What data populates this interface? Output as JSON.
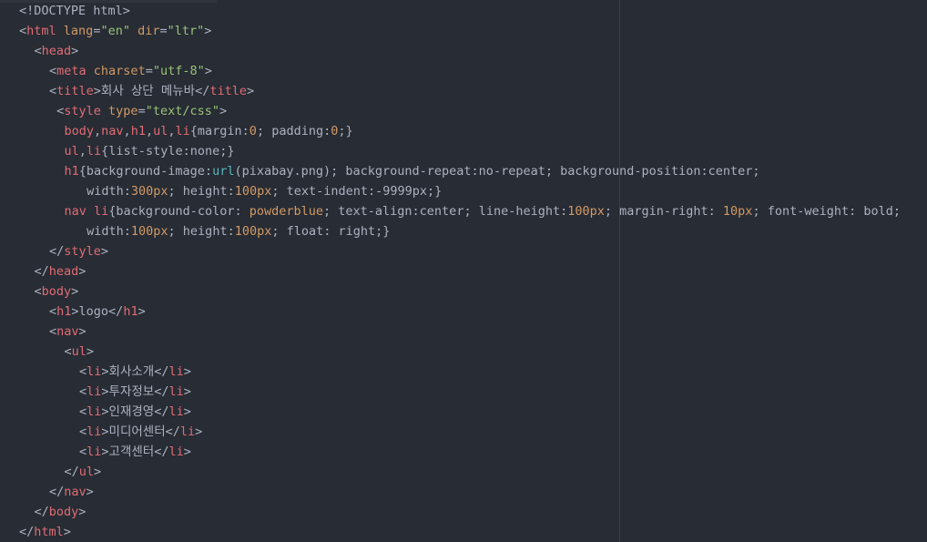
{
  "editor": {
    "theme_colors": {
      "background": "#282c34",
      "plain": "#abb2bf",
      "tag": "#e06c75",
      "attr": "#d19a66",
      "string": "#98c379",
      "number": "#d19a66",
      "function": "#56b6c2"
    },
    "lines": [
      {
        "indent": 1,
        "tokens": [
          {
            "t": "plain",
            "v": "<!DOCTYPE html>"
          }
        ]
      },
      {
        "indent": 1,
        "tokens": [
          {
            "t": "plain",
            "v": "<"
          },
          {
            "t": "tag",
            "v": "html"
          },
          {
            "t": "plain",
            "v": " "
          },
          {
            "t": "attr",
            "v": "lang"
          },
          {
            "t": "plain",
            "v": "="
          },
          {
            "t": "str",
            "v": "\"en\""
          },
          {
            "t": "plain",
            "v": " "
          },
          {
            "t": "attr",
            "v": "dir"
          },
          {
            "t": "plain",
            "v": "="
          },
          {
            "t": "str",
            "v": "\"ltr\""
          },
          {
            "t": "plain",
            "v": ">"
          }
        ]
      },
      {
        "indent": 2,
        "tokens": [
          {
            "t": "plain",
            "v": "<"
          },
          {
            "t": "tag",
            "v": "head"
          },
          {
            "t": "plain",
            "v": ">"
          }
        ]
      },
      {
        "indent": 3,
        "tokens": [
          {
            "t": "plain",
            "v": "<"
          },
          {
            "t": "tag",
            "v": "meta"
          },
          {
            "t": "plain",
            "v": " "
          },
          {
            "t": "attr",
            "v": "charset"
          },
          {
            "t": "plain",
            "v": "="
          },
          {
            "t": "str",
            "v": "\"utf-8\""
          },
          {
            "t": "plain",
            "v": ">"
          }
        ]
      },
      {
        "indent": 3,
        "tokens": [
          {
            "t": "plain",
            "v": "<"
          },
          {
            "t": "tag",
            "v": "title"
          },
          {
            "t": "plain",
            "v": ">회사 상단 메뉴바</"
          },
          {
            "t": "tag",
            "v": "title"
          },
          {
            "t": "plain",
            "v": ">"
          }
        ]
      },
      {
        "indent": 3,
        "tokens": [
          {
            "t": "plain",
            "v": " <"
          },
          {
            "t": "tag",
            "v": "style"
          },
          {
            "t": "plain",
            "v": " "
          },
          {
            "t": "attr",
            "v": "type"
          },
          {
            "t": "plain",
            "v": "="
          },
          {
            "t": "str",
            "v": "\"text/css\""
          },
          {
            "t": "plain",
            "v": ">"
          }
        ]
      },
      {
        "indent": 4,
        "tokens": [
          {
            "t": "tag",
            "v": "body"
          },
          {
            "t": "plain",
            "v": ","
          },
          {
            "t": "tag",
            "v": "nav"
          },
          {
            "t": "plain",
            "v": ","
          },
          {
            "t": "tag",
            "v": "h1"
          },
          {
            "t": "plain",
            "v": ","
          },
          {
            "t": "tag",
            "v": "ul"
          },
          {
            "t": "plain",
            "v": ","
          },
          {
            "t": "tag",
            "v": "li"
          },
          {
            "t": "plain",
            "v": "{margin:"
          },
          {
            "t": "num",
            "v": "0"
          },
          {
            "t": "plain",
            "v": "; padding:"
          },
          {
            "t": "num",
            "v": "0"
          },
          {
            "t": "plain",
            "v": ";}"
          }
        ]
      },
      {
        "indent": 4,
        "tokens": [
          {
            "t": "tag",
            "v": "ul"
          },
          {
            "t": "plain",
            "v": ","
          },
          {
            "t": "tag",
            "v": "li"
          },
          {
            "t": "plain",
            "v": "{list-style:none;}"
          }
        ]
      },
      {
        "indent": 4,
        "tokens": [
          {
            "t": "tag",
            "v": "h1"
          },
          {
            "t": "plain",
            "v": "{background-image:"
          },
          {
            "t": "fn",
            "v": "url"
          },
          {
            "t": "plain",
            "v": "(pixabay.png); background-repeat:no-repeat; background-position:center;"
          }
        ]
      },
      {
        "indent": 5,
        "tokens": [
          {
            "t": "plain",
            "v": " width:"
          },
          {
            "t": "num",
            "v": "300px"
          },
          {
            "t": "plain",
            "v": "; height:"
          },
          {
            "t": "num",
            "v": "100px"
          },
          {
            "t": "plain",
            "v": "; text-indent:-9999px;}"
          }
        ]
      },
      {
        "indent": 4,
        "tokens": [
          {
            "t": "tag",
            "v": "nav"
          },
          {
            "t": "plain",
            "v": " "
          },
          {
            "t": "tag",
            "v": "li"
          },
          {
            "t": "plain",
            "v": "{background-color: "
          },
          {
            "t": "num",
            "v": "powderblue"
          },
          {
            "t": "plain",
            "v": "; text-align:center; line-height:"
          },
          {
            "t": "num",
            "v": "100px"
          },
          {
            "t": "plain",
            "v": "; margin-right: "
          },
          {
            "t": "num",
            "v": "10px"
          },
          {
            "t": "plain",
            "v": "; font-weight: bold;"
          }
        ]
      },
      {
        "indent": 5,
        "tokens": [
          {
            "t": "plain",
            "v": " width:"
          },
          {
            "t": "num",
            "v": "100px"
          },
          {
            "t": "plain",
            "v": "; height:"
          },
          {
            "t": "num",
            "v": "100px"
          },
          {
            "t": "plain",
            "v": "; float: right;}"
          }
        ]
      },
      {
        "indent": 3,
        "tokens": [
          {
            "t": "plain",
            "v": "</"
          },
          {
            "t": "tag",
            "v": "style"
          },
          {
            "t": "plain",
            "v": ">"
          }
        ]
      },
      {
        "indent": 2,
        "tokens": [
          {
            "t": "plain",
            "v": "</"
          },
          {
            "t": "tag",
            "v": "head"
          },
          {
            "t": "plain",
            "v": ">"
          }
        ]
      },
      {
        "indent": 2,
        "tokens": [
          {
            "t": "plain",
            "v": "<"
          },
          {
            "t": "tag",
            "v": "body"
          },
          {
            "t": "plain",
            "v": ">"
          }
        ]
      },
      {
        "indent": 3,
        "tokens": [
          {
            "t": "plain",
            "v": "<"
          },
          {
            "t": "tag",
            "v": "h1"
          },
          {
            "t": "plain",
            "v": ">logo</"
          },
          {
            "t": "tag",
            "v": "h1"
          },
          {
            "t": "plain",
            "v": ">"
          }
        ]
      },
      {
        "indent": 3,
        "tokens": [
          {
            "t": "plain",
            "v": "<"
          },
          {
            "t": "tag",
            "v": "nav"
          },
          {
            "t": "plain",
            "v": ">"
          }
        ]
      },
      {
        "indent": 4,
        "tokens": [
          {
            "t": "plain",
            "v": "<"
          },
          {
            "t": "tag",
            "v": "ul"
          },
          {
            "t": "plain",
            "v": ">"
          }
        ]
      },
      {
        "indent": 5,
        "tokens": [
          {
            "t": "plain",
            "v": "<"
          },
          {
            "t": "tag",
            "v": "li"
          },
          {
            "t": "plain",
            "v": ">회사소개</"
          },
          {
            "t": "tag",
            "v": "li"
          },
          {
            "t": "plain",
            "v": ">"
          }
        ]
      },
      {
        "indent": 5,
        "tokens": [
          {
            "t": "plain",
            "v": "<"
          },
          {
            "t": "tag",
            "v": "li"
          },
          {
            "t": "plain",
            "v": ">투자정보</"
          },
          {
            "t": "tag",
            "v": "li"
          },
          {
            "t": "plain",
            "v": ">"
          }
        ]
      },
      {
        "indent": 5,
        "tokens": [
          {
            "t": "plain",
            "v": "<"
          },
          {
            "t": "tag",
            "v": "li"
          },
          {
            "t": "plain",
            "v": ">인재경영</"
          },
          {
            "t": "tag",
            "v": "li"
          },
          {
            "t": "plain",
            "v": ">"
          }
        ]
      },
      {
        "indent": 5,
        "tokens": [
          {
            "t": "plain",
            "v": "<"
          },
          {
            "t": "tag",
            "v": "li"
          },
          {
            "t": "plain",
            "v": ">미디어센터</"
          },
          {
            "t": "tag",
            "v": "li"
          },
          {
            "t": "plain",
            "v": ">"
          }
        ]
      },
      {
        "indent": 5,
        "tokens": [
          {
            "t": "plain",
            "v": "<"
          },
          {
            "t": "tag",
            "v": "li"
          },
          {
            "t": "plain",
            "v": ">고객센터</"
          },
          {
            "t": "tag",
            "v": "li"
          },
          {
            "t": "plain",
            "v": ">"
          }
        ]
      },
      {
        "indent": 4,
        "tokens": [
          {
            "t": "plain",
            "v": "</"
          },
          {
            "t": "tag",
            "v": "ul"
          },
          {
            "t": "plain",
            "v": ">"
          }
        ]
      },
      {
        "indent": 3,
        "tokens": [
          {
            "t": "plain",
            "v": "</"
          },
          {
            "t": "tag",
            "v": "nav"
          },
          {
            "t": "plain",
            "v": ">"
          }
        ]
      },
      {
        "indent": 2,
        "tokens": [
          {
            "t": "plain",
            "v": "</"
          },
          {
            "t": "tag",
            "v": "body"
          },
          {
            "t": "plain",
            "v": ">"
          }
        ]
      },
      {
        "indent": 1,
        "tokens": [
          {
            "t": "plain",
            "v": "</"
          },
          {
            "t": "tag",
            "v": "html"
          },
          {
            "t": "plain",
            "v": ">"
          }
        ]
      }
    ]
  }
}
